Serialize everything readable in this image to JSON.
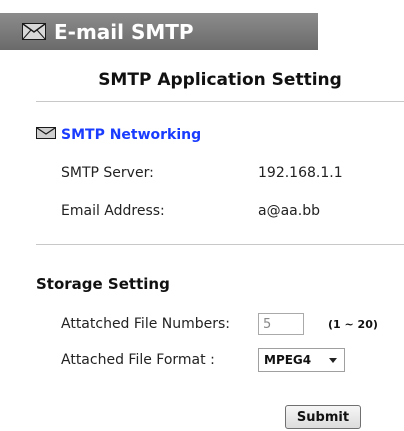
{
  "header": {
    "title": "E-mail SMTP",
    "icon": "envelope-icon"
  },
  "page_title": "SMTP Application Setting",
  "smtp_section": {
    "heading": "SMTP Networking",
    "icon": "envelope-icon",
    "heading_color": "#1a3cff",
    "server_label": "SMTP Server:",
    "server_value": "192.168.1.1",
    "email_label": "Email Address:",
    "email_value": "a@aa.bb"
  },
  "storage": {
    "title": "Storage Setting",
    "file_numbers_label": "Attatched File Numbers:",
    "file_numbers_value": "5",
    "file_numbers_range": "(1 ~ 20)",
    "file_format_label": "Attached File Format :",
    "file_format_value": "MPEG4"
  },
  "actions": {
    "submit_label": "Submit"
  }
}
